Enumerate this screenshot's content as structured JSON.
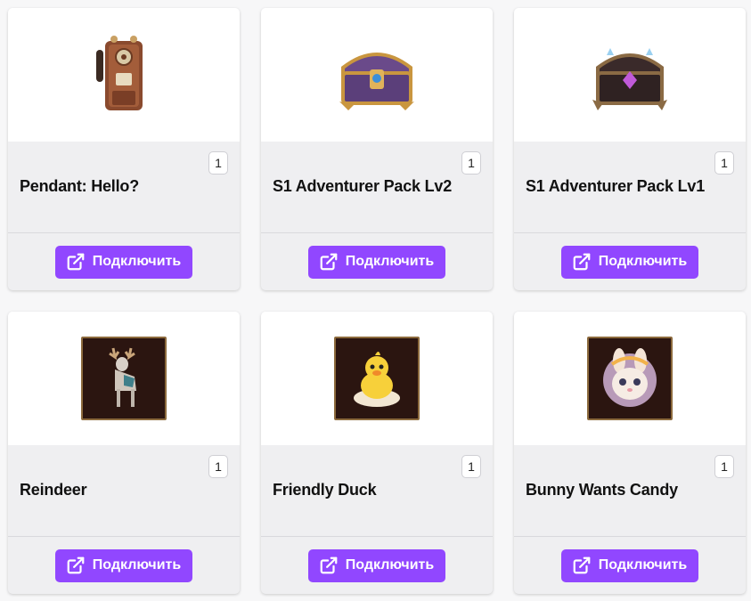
{
  "cards": [
    {
      "title": "Pendant: Hello?",
      "quantity": "1",
      "button_label": "Подключить",
      "icon": "vintage-phone-icon"
    },
    {
      "title": "S1 Adventurer Pack Lv2",
      "quantity": "1",
      "button_label": "Подключить",
      "icon": "treasure-chest-gold-icon"
    },
    {
      "title": "S1 Adventurer Pack Lv1",
      "quantity": "1",
      "button_label": "Подключить",
      "icon": "treasure-chest-purple-icon"
    },
    {
      "title": "Reindeer",
      "quantity": "1",
      "button_label": "Подключить",
      "icon": "reindeer-icon"
    },
    {
      "title": "Friendly Duck",
      "quantity": "1",
      "button_label": "Подключить",
      "icon": "duck-icon"
    },
    {
      "title": "Bunny Wants Candy",
      "quantity": "1",
      "button_label": "Подключить",
      "icon": "bunny-icon"
    }
  ],
  "colors": {
    "accent": "#9147ff",
    "card_bg": "#efeff1",
    "page_bg": "#f7f7f8"
  }
}
